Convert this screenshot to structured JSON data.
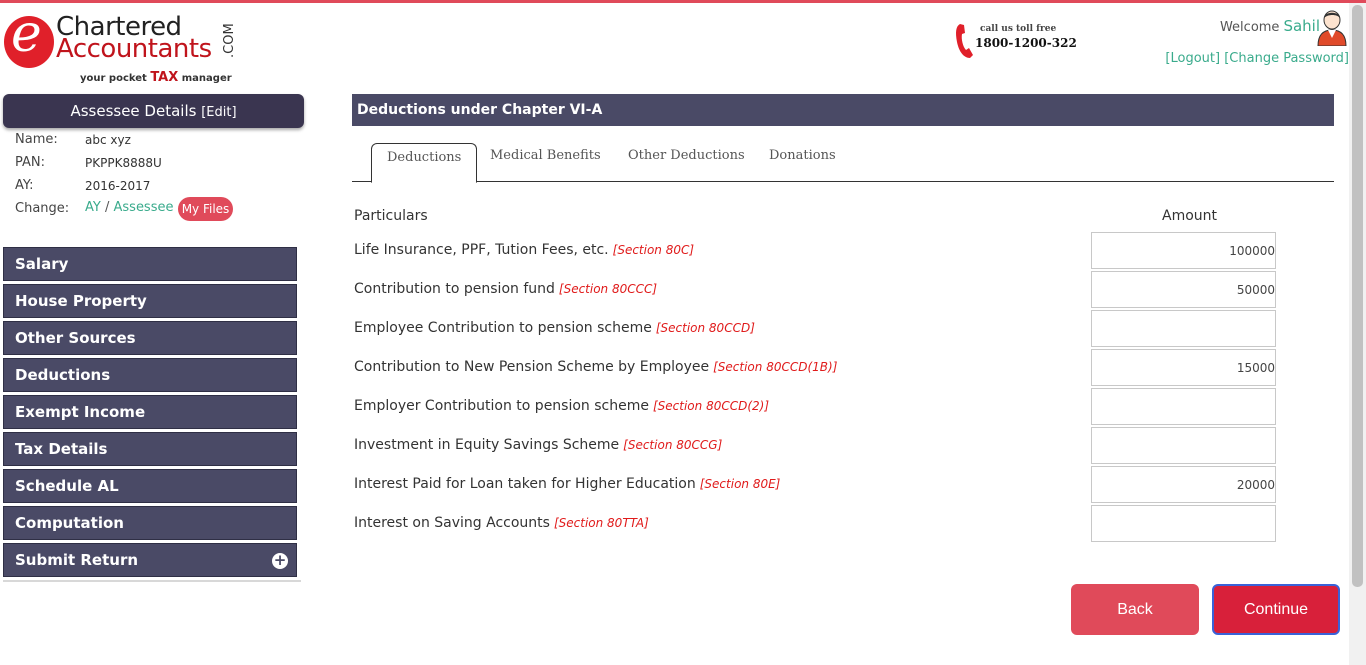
{
  "brand": {
    "logo_e": "e",
    "logo_line1": "Chartered",
    "logo_line2": "Accountants",
    "logo_com": ".COM",
    "tagline_pre": "your pocket",
    "tagline_tax": "TAX",
    "tagline_post": "manager"
  },
  "toll_free": {
    "label": "call us toll free",
    "number": "1800-1200-322"
  },
  "user": {
    "welcome": "Welcome",
    "name": "Sahil",
    "logout": "[Logout]",
    "change_password": "[Change Password]"
  },
  "assessee": {
    "title": "Assessee Details",
    "edit": "[Edit]",
    "fields": [
      {
        "label": "Name:",
        "value": "abc xyz"
      },
      {
        "label": "PAN:",
        "value": "PKPPK8888U"
      },
      {
        "label": "AY:",
        "value": "2016-2017"
      }
    ],
    "change_label": "Change:",
    "change_ay": "AY",
    "change_sep": "/",
    "change_assessee": "Assessee",
    "my_files": "My Files"
  },
  "nav": [
    {
      "label": "Salary"
    },
    {
      "label": "House Property"
    },
    {
      "label": "Other Sources"
    },
    {
      "label": "Deductions"
    },
    {
      "label": "Exempt Income"
    },
    {
      "label": "Tax Details"
    },
    {
      "label": "Schedule AL"
    },
    {
      "label": "Computation"
    },
    {
      "label": "Submit Return",
      "icon": "plus-circle-icon"
    }
  ],
  "main": {
    "title": "Deductions under Chapter VI-A",
    "tabs": [
      "Deductions",
      "Medical Benefits",
      "Other Deductions",
      "Donations"
    ],
    "active_tab": "Deductions",
    "col_particulars": "Particulars",
    "col_amount": "Amount",
    "rows": [
      {
        "label": "Life Insurance, PPF, Tution Fees, etc.",
        "section": "[Section 80C]",
        "amount": "100000"
      },
      {
        "label": "Contribution to pension fund",
        "section": "[Section 80CCC]",
        "amount": "50000"
      },
      {
        "label": "Employee Contribution to pension scheme",
        "section": "[Section 80CCD]",
        "amount": ""
      },
      {
        "label": "Contribution to New Pension Scheme by Employee",
        "section": "[Section 80CCD(1B)]",
        "amount": "15000"
      },
      {
        "label": "Employer Contribution to pension scheme",
        "section": "[Section 80CCD(2)]",
        "amount": ""
      },
      {
        "label": "Investment in Equity Savings Scheme",
        "section": "[Section 80CCG]",
        "amount": ""
      },
      {
        "label": "Interest Paid for Loan taken for Higher Education",
        "section": "[Section 80E]",
        "amount": "20000"
      },
      {
        "label": "Interest on Saving Accounts",
        "section": "[Section 80TTA]",
        "amount": ""
      }
    ],
    "back": "Back",
    "continue": "Continue"
  },
  "colors": {
    "accent_red": "#e04a5a",
    "nav_bg": "#4a4a66",
    "link_green": "#3aab8c",
    "section_red": "#e01b1b"
  }
}
